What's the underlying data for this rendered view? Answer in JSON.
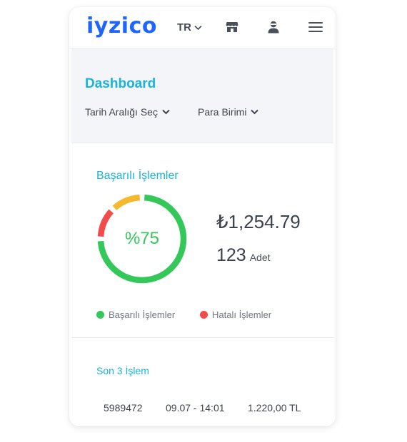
{
  "header": {
    "logo": "iyzico",
    "language": "TR",
    "icons": [
      "store-icon",
      "user-icon",
      "hamburger-menu-icon"
    ]
  },
  "dashboard": {
    "title": "Dashboard",
    "date_filter_label": "Tarih Aralığı Seç",
    "currency_filter_label": "Para Birimi"
  },
  "success_card": {
    "title": "Başarılı İşlemler",
    "percentage_label": "%75",
    "amount": "₺1,254.79",
    "count": "123",
    "count_unit": "Adet",
    "legend": [
      {
        "label": "Başarılı İşlemler",
        "color": "#34c759"
      },
      {
        "label": "Hatalı İşlemler",
        "color": "#f14b4b"
      }
    ],
    "donut_segments": [
      {
        "name": "success",
        "value": 0.75,
        "color": "#34c759"
      },
      {
        "name": "error",
        "value": 0.125,
        "color": "#f14b4b"
      },
      {
        "name": "pending",
        "value": 0.125,
        "color": "#f5b82e"
      }
    ]
  },
  "last_transactions": {
    "title": "Son 3 İşlem",
    "rows": [
      {
        "id": "5989472",
        "date": "09.07 - 14:01",
        "amount": "1.220,00 TL"
      }
    ]
  },
  "colors": {
    "brand": "#1e64ff",
    "accent": "#19b4d8",
    "success": "#34c759",
    "error": "#f14b4b",
    "warning": "#f5b82e"
  }
}
